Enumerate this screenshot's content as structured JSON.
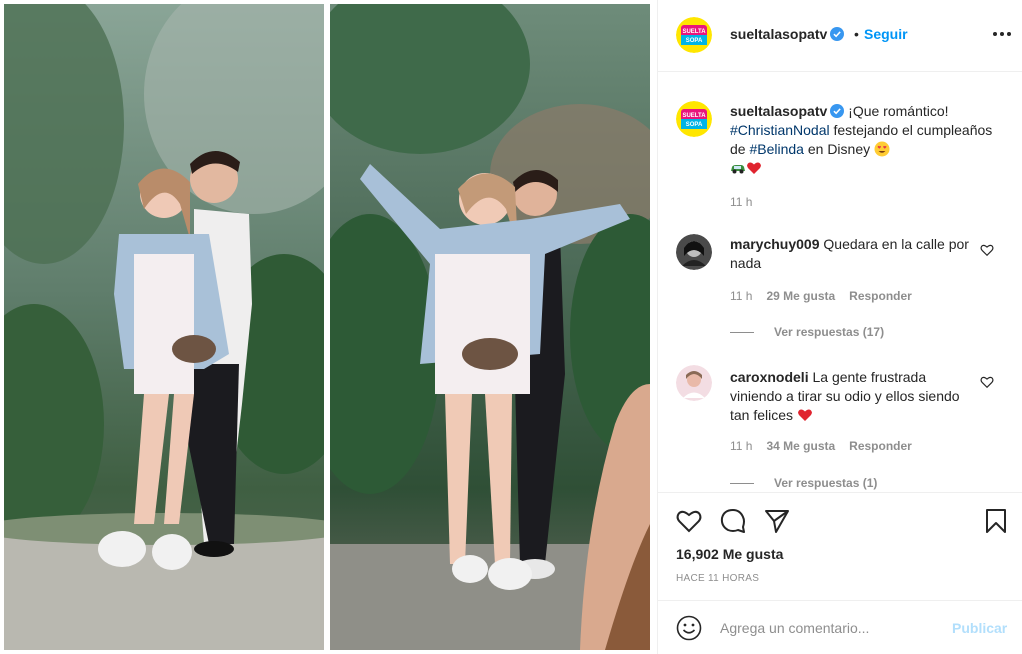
{
  "post": {
    "author": "sueltalasopatv",
    "follow_label": "Seguir",
    "separator": "•",
    "avatar_text": "SUELTA SOPA",
    "colors": {
      "accent": "#0095f6",
      "verified": "#3897f0",
      "heart": "#ed4956",
      "muted": "#8e8e8e",
      "publish_disabled": "#b2dffc"
    }
  },
  "caption": {
    "username": "sueltalasopatv",
    "text_1": "¡Que romántico! ",
    "tag_1": "#ChristianNodal",
    "text_2": " festejando el cumpleaños de ",
    "tag_2": "#Belinda",
    "text_3": " en Disney ",
    "emojis": [
      "heart-eyes-emoji",
      "car-emoji",
      "red-heart-emoji"
    ],
    "time": "11 h"
  },
  "comments": [
    {
      "username": "marychuy009",
      "text": "Quedara en la calle por nada",
      "time": "11 h",
      "likes": "29 Me gusta",
      "reply": "Responder",
      "view_replies": "Ver respuestas (17)"
    },
    {
      "username": "caroxnodeli",
      "text": "La gente frustrada viniendo a tirar su odio y ellos siendo tan felices",
      "time": "11 h",
      "likes": "34 Me gusta",
      "reply": "Responder",
      "view_replies": "Ver respuestas (1)"
    }
  ],
  "stats": {
    "likes": "16,902 Me gusta",
    "ago": "HACE 11 HORAS"
  },
  "composer": {
    "placeholder": "Agrega un comentario...",
    "publish_label": "Publicar"
  },
  "icons": [
    "heart-icon",
    "comment-icon",
    "share-icon",
    "bookmark-icon",
    "smile-icon",
    "more-icon",
    "verified-icon"
  ]
}
